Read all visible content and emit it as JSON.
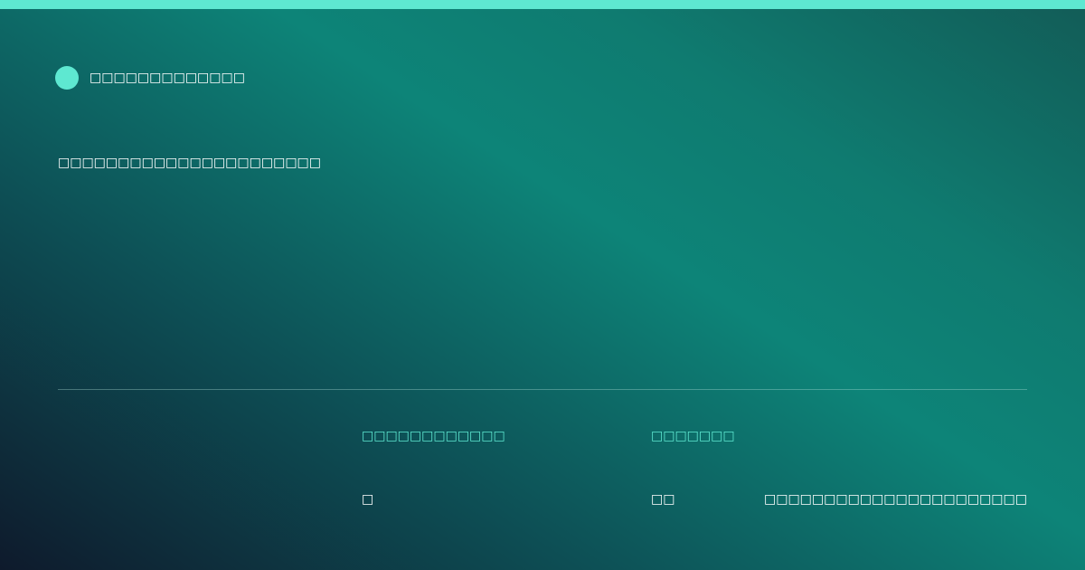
{
  "colors": {
    "accent": "#5ee8d1",
    "background_start": "#0e1a2c",
    "background_mid": "#0d8478",
    "background_end": "#125c57",
    "text": "#ffffff"
  },
  "brand": {
    "icon": "brand-dot-icon",
    "name": "□□□□□□□□□□□□□"
  },
  "headline": "□□□□□□□□□□□□□□□□□□□□□□",
  "stats": [
    {
      "label": "□□□□□□□□□□□□",
      "value": "□"
    },
    {
      "label": "□□□□□□□",
      "value": "□□"
    }
  ],
  "footer_note": "□□□□□□□□□□□□□□□□□□□□□□"
}
